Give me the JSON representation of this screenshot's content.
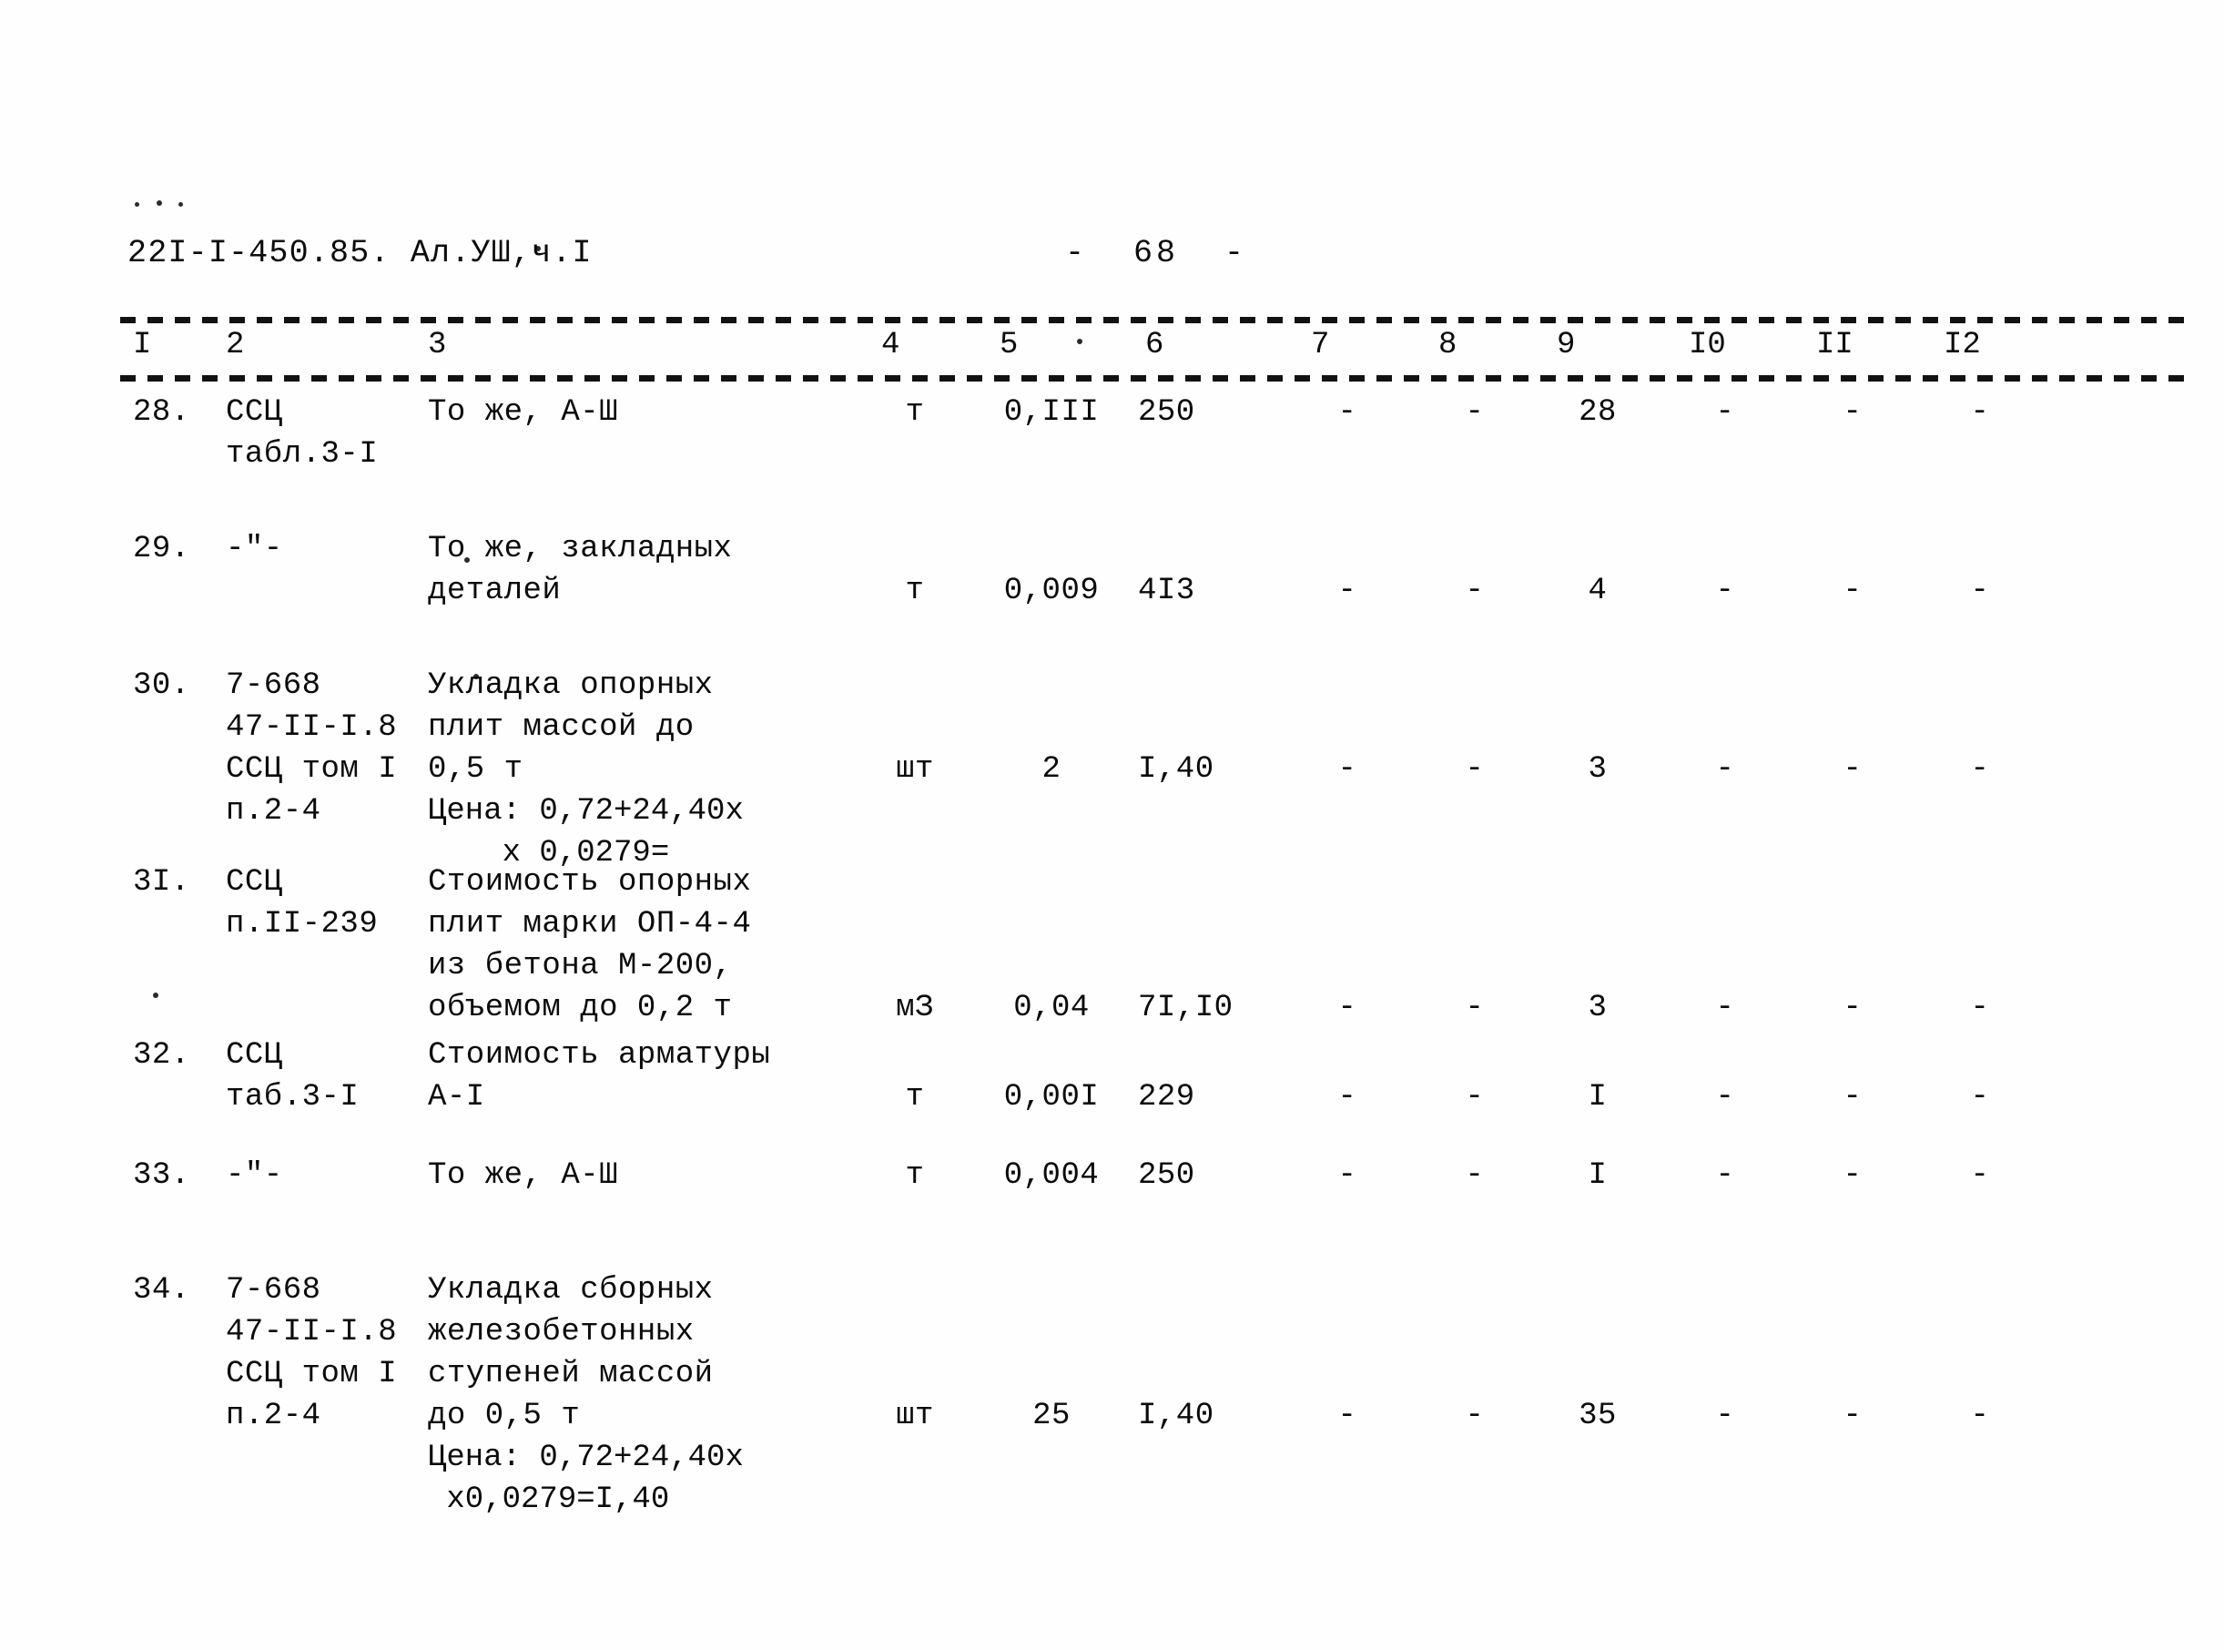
{
  "document": {
    "code": "22I-I-450.85. Ал.УШ,ч.I",
    "page_marker": "-  68  -"
  },
  "table": {
    "column_headers": [
      "I",
      "2",
      "3",
      "4",
      "5",
      "6",
      "7",
      "8",
      "9",
      "I0",
      "II",
      "I2"
    ],
    "rows": [
      {
        "num": "28.",
        "ref": "ССЦ\nтабл.3-I",
        "description": "То же, А-Ш",
        "unit": "т",
        "qty": "0,III",
        "price": "250",
        "c7": "-",
        "c8": "-",
        "c9": "28",
        "c10": "-",
        "c11": "-",
        "c12": "-"
      },
      {
        "num": "29.",
        "ref": "-\"-",
        "description": "То же, закладных\nдеталей",
        "unit": "т",
        "qty": "0,009",
        "price": "4I3",
        "c7": "-",
        "c8": "-",
        "c9": "4",
        "c10": "-",
        "c11": "-",
        "c12": "-"
      },
      {
        "num": "30.",
        "ref": "7-668\n47-II-I.8\nССЦ том I\nп.2-4",
        "description": "Укладка опорных\nплит массой до\n0,5 т",
        "note": "Цена: 0,72+24,40х\n    х 0,0279=",
        "unit": "шт",
        "qty": "2",
        "price": "I,40",
        "c7": "-",
        "c8": "-",
        "c9": "3",
        "c10": "-",
        "c11": "-",
        "c12": "-"
      },
      {
        "num": "3I.",
        "ref": "ССЦ\nп.II-239",
        "description": "Стоимость опорных\nплит марки ОП-4-4\nиз бетона М-200,\nобъемом до 0,2 т",
        "unit": "мЗ",
        "qty": "0,04",
        "price": "7I,I0",
        "c7": "-",
        "c8": "-",
        "c9": "3",
        "c10": "-",
        "c11": "-",
        "c12": "-"
      },
      {
        "num": "32.",
        "ref": "ССЦ\nтаб.3-I",
        "description": "Стоимость арматуры\nА-I",
        "unit": "т",
        "qty": "0,00I",
        "price": "229",
        "c7": "-",
        "c8": "-",
        "c9": "I",
        "c10": "-",
        "c11": "-",
        "c12": "-"
      },
      {
        "num": "33.",
        "ref": "-\"-",
        "description": "То же, А-Ш",
        "unit": "т",
        "qty": "0,004",
        "price": "250",
        "c7": "-",
        "c8": "-",
        "c9": "I",
        "c10": "-",
        "c11": "-",
        "c12": "-"
      },
      {
        "num": "34.",
        "ref": "7-668\n47-II-I.8\nССЦ том I\nп.2-4",
        "description": "Укладка сборных\nжелезобетонных\nступеней массой\nдо 0,5 т",
        "note": "Цена: 0,72+24,40х\n х0,0279=I,40",
        "unit": "шт",
        "qty": "25",
        "price": "I,40",
        "c7": "-",
        "c8": "-",
        "c9": "35",
        "c10": "-",
        "c11": "-",
        "c12": "-"
      }
    ]
  }
}
